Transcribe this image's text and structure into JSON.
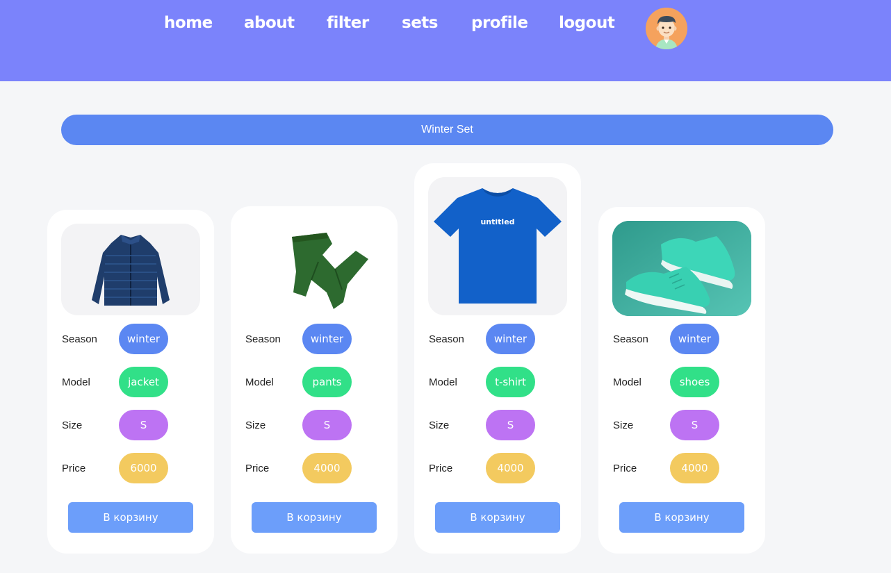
{
  "nav": {
    "home": "home",
    "about": "about",
    "filter": "filter",
    "sets": "sets",
    "profile": "profile",
    "logout": "logout"
  },
  "set_title": "Winter Set",
  "labels": {
    "season": "Season",
    "model": "Model",
    "size": "Size",
    "price": "Price"
  },
  "cart_button_label": "В корзину",
  "products": [
    {
      "season": "winter",
      "model": "jacket",
      "size": "S",
      "price": "6000",
      "image": "navy puffer jacket"
    },
    {
      "season": "winter",
      "model": "pants",
      "size": "S",
      "price": "4000",
      "image": "green pants"
    },
    {
      "season": "winter",
      "model": "t-shirt",
      "size": "S",
      "price": "4000",
      "image": "blue t-shirt",
      "image_text": "untitled"
    },
    {
      "season": "winter",
      "model": "shoes",
      "size": "S",
      "price": "4000",
      "image": "teal sneakers"
    }
  ],
  "colors": {
    "header": "#7b83fb",
    "accent_blue": "#5b87f2",
    "model_green": "#31e088",
    "size_purple": "#bd73f3",
    "price_yellow": "#f3ca5f",
    "button_blue": "#6c9efa"
  }
}
